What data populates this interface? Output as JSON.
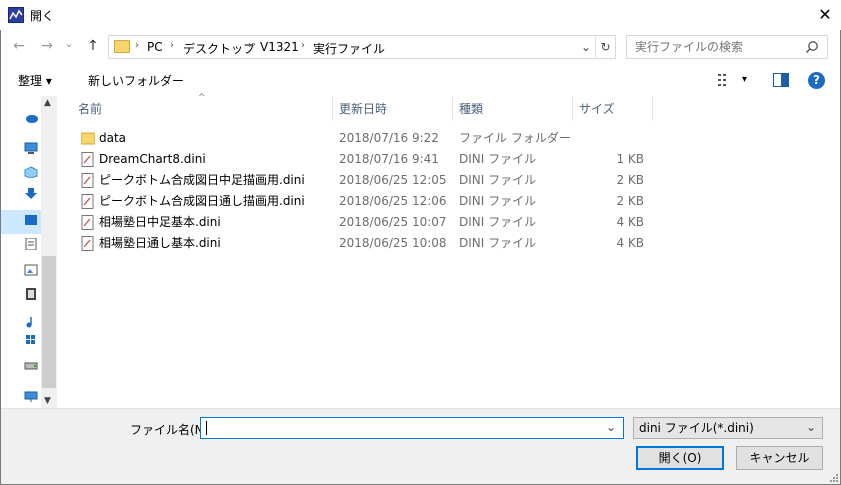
{
  "window": {
    "title": "開く",
    "close_label": "✕"
  },
  "nav": {
    "back": "←",
    "forward": "→",
    "recent": "⌄",
    "up": "↑"
  },
  "address": {
    "crumbs": [
      "PC",
      "デスクトップ",
      "V1321",
      "実行ファイル"
    ],
    "sep": "›",
    "dropdown": "⌄",
    "refresh": "↻"
  },
  "search": {
    "placeholder": "実行ファイルの検索"
  },
  "toolbar": {
    "organize": "整理 ▾",
    "new_folder": "新しいフォルダー",
    "view_menu": "▾",
    "help": "?"
  },
  "columns": {
    "name": "名前",
    "date": "更新日時",
    "type": "種類",
    "size": "サイズ",
    "sort_indicator": "^"
  },
  "files": [
    {
      "name": "data",
      "date": "2018/07/16 9:22",
      "type": "ファイル フォルダー",
      "size": "",
      "kind": "folder"
    },
    {
      "name": "DreamChart8.dini",
      "date": "2018/07/16 9:41",
      "type": "DINI ファイル",
      "size": "1 KB",
      "kind": "file"
    },
    {
      "name": "ピークボトム合成図日中足描画用.dini",
      "date": "2018/06/25 12:05",
      "type": "DINI ファイル",
      "size": "2 KB",
      "kind": "file"
    },
    {
      "name": "ピークボトム合成図日通し描画用.dini",
      "date": "2018/06/25 12:06",
      "type": "DINI ファイル",
      "size": "2 KB",
      "kind": "file"
    },
    {
      "name": "相場塾日中足基本.dini",
      "date": "2018/06/25 10:07",
      "type": "DINI ファイル",
      "size": "4 KB",
      "kind": "file"
    },
    {
      "name": "相場塾日通し基本.dini",
      "date": "2018/06/25 10:08",
      "type": "DINI ファイル",
      "size": "4 KB",
      "kind": "file"
    }
  ],
  "footer": {
    "filename_label": "ファイル名(N):",
    "filename_value": "",
    "filename_dropdown": "⌄",
    "filter_value": "dini ファイル(*.dini)",
    "filter_dropdown": "⌄",
    "open_button": "開く(O)",
    "cancel_button": "キャンセル"
  },
  "colors": {
    "accent": "#0078d7",
    "selection": "#cce8ff",
    "folder": "#f7d46c",
    "help": "#1a6ac8"
  }
}
